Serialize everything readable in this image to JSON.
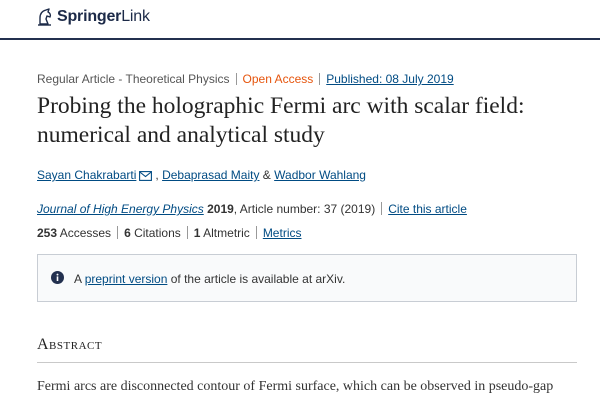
{
  "header": {
    "brand_strong": "Springer",
    "brand_light": "Link"
  },
  "meta": {
    "article_type": "Regular Article - Theoretical Physics",
    "access": "Open Access",
    "published": "Published: 08 July 2019"
  },
  "article": {
    "title_line1": "Probing the holographic Fermi arc with scalar field:",
    "title_line2": "numerical and analytical study"
  },
  "authors": {
    "author1": "Sayan Chakrabarti",
    "author2": "Debaprasad Maity",
    "ampersand": "&",
    "author3": "Wadbor Wahlang"
  },
  "citation": {
    "journal": "Journal of High Energy Physics",
    "year": "2019",
    "article_number": ", Article number: 37 (2019)",
    "cite_label": "Cite this article"
  },
  "metrics": {
    "accesses_count": "253",
    "accesses_label": "Accesses",
    "citations_count": "6",
    "citations_label": "Citations",
    "altmetric_count": "1",
    "altmetric_label": "Altmetric",
    "metrics_link": "Metrics"
  },
  "notice": {
    "prefix": "A",
    "link": "preprint version",
    "suffix": "of the article is available at arXiv."
  },
  "abstract": {
    "heading": "Abstract",
    "text_start": "Fermi arcs are disconnected contour of Fermi surface, which can be observed in pseudo-gap"
  },
  "colors": {
    "brand_navy": "#1c2a48",
    "link_blue": "#004b83",
    "open_access_orange": "#e6550d",
    "info_icon": "#23304f"
  },
  "icons": {
    "brand_logo": "springer-horse-icon",
    "author_email": "envelope-icon",
    "notice": "info-icon"
  }
}
